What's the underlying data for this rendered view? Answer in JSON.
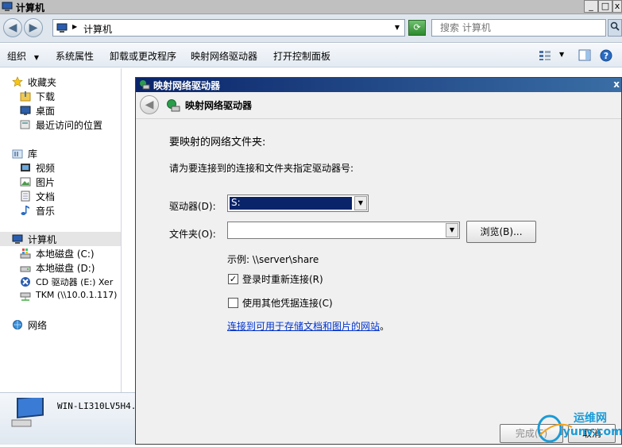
{
  "window": {
    "title": "计算机",
    "controls": [
      "_",
      "□",
      "x"
    ]
  },
  "address": {
    "path": "计算机",
    "search_placeholder": "搜索 计算机"
  },
  "toolbar": {
    "organize": "组织",
    "system_properties": "系统属性",
    "uninstall": "卸载或更改程序",
    "map_drive": "映射网络驱动器",
    "control_panel": "打开控制面板"
  },
  "sidebar": {
    "favorites": "收藏夹",
    "downloads": "下载",
    "desktop": "桌面",
    "recent": "最近访问的位置",
    "libraries": "库",
    "videos": "视频",
    "pictures": "图片",
    "documents": "文档",
    "music": "音乐",
    "computer": "计算机",
    "drive_c": "本地磁盘 (C:)",
    "drive_d": "本地磁盘 (D:)",
    "drive_e": "CD 驱动器 (E:) Xer",
    "drive_tkm": "TKM (\\\\10.0.1.117)",
    "network": "网络"
  },
  "details": {
    "computer_name": "WIN-LI310LV5H4."
  },
  "dialog": {
    "title": "映射网络驱动器",
    "header": "映射网络驱动器",
    "heading": "要映射的网络文件夹:",
    "instruction": "请为要连接到的连接和文件夹指定驱动器号:",
    "drive_label": "驱动器(D):",
    "drive_value": "S:",
    "folder_label": "文件夹(O):",
    "folder_value": "",
    "browse_label": "浏览(B)...",
    "example": "示例: \\\\server\\share",
    "reconnect_label": "登录时重新连接(R)",
    "reconnect_checked": true,
    "other_creds_label": "使用其他凭据连接(C)",
    "other_creds_checked": false,
    "link_text": "连接到可用于存储文档和图片的网站",
    "link_suffix": "。",
    "finish_label": "完成(F)",
    "cancel_label": "取消"
  },
  "watermark": {
    "text_top": "运维网",
    "text_bottom": "iyunv.com"
  },
  "colors": {
    "dialog_title": "#0a246a",
    "selection": "#0a246a",
    "link": "#0033cc"
  }
}
